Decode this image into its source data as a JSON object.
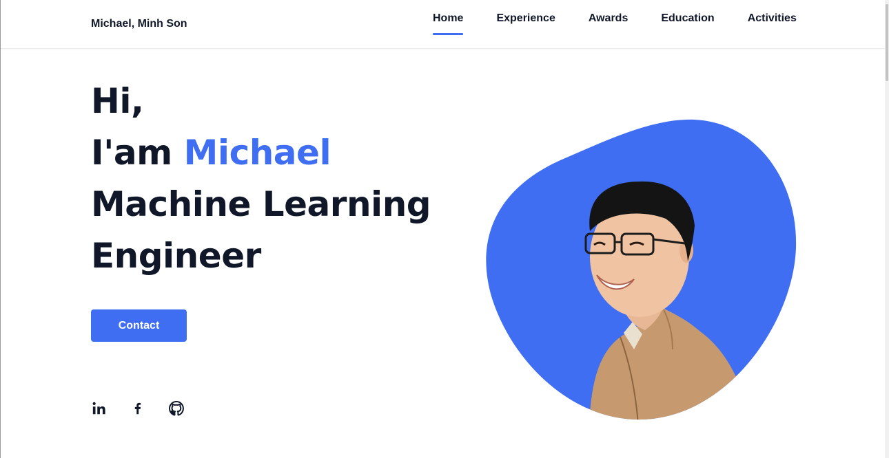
{
  "header": {
    "brand": "Michael, Minh Son",
    "nav": [
      {
        "label": "Home",
        "active": true
      },
      {
        "label": "Experience",
        "active": false
      },
      {
        "label": "Awards",
        "active": false
      },
      {
        "label": "Education",
        "active": false
      },
      {
        "label": "Activities",
        "active": false
      }
    ]
  },
  "hero": {
    "greeting": "Hi,",
    "intro_prefix": "I'am ",
    "name": "Michael",
    "role_line1": "Machine Learning",
    "role_line2": "Engineer",
    "contact_label": "Contact"
  },
  "socials": [
    {
      "icon": "linkedin-icon"
    },
    {
      "icon": "facebook-icon"
    },
    {
      "icon": "github-icon"
    }
  ],
  "colors": {
    "accent": "#3f6ef3",
    "text": "#101729"
  }
}
